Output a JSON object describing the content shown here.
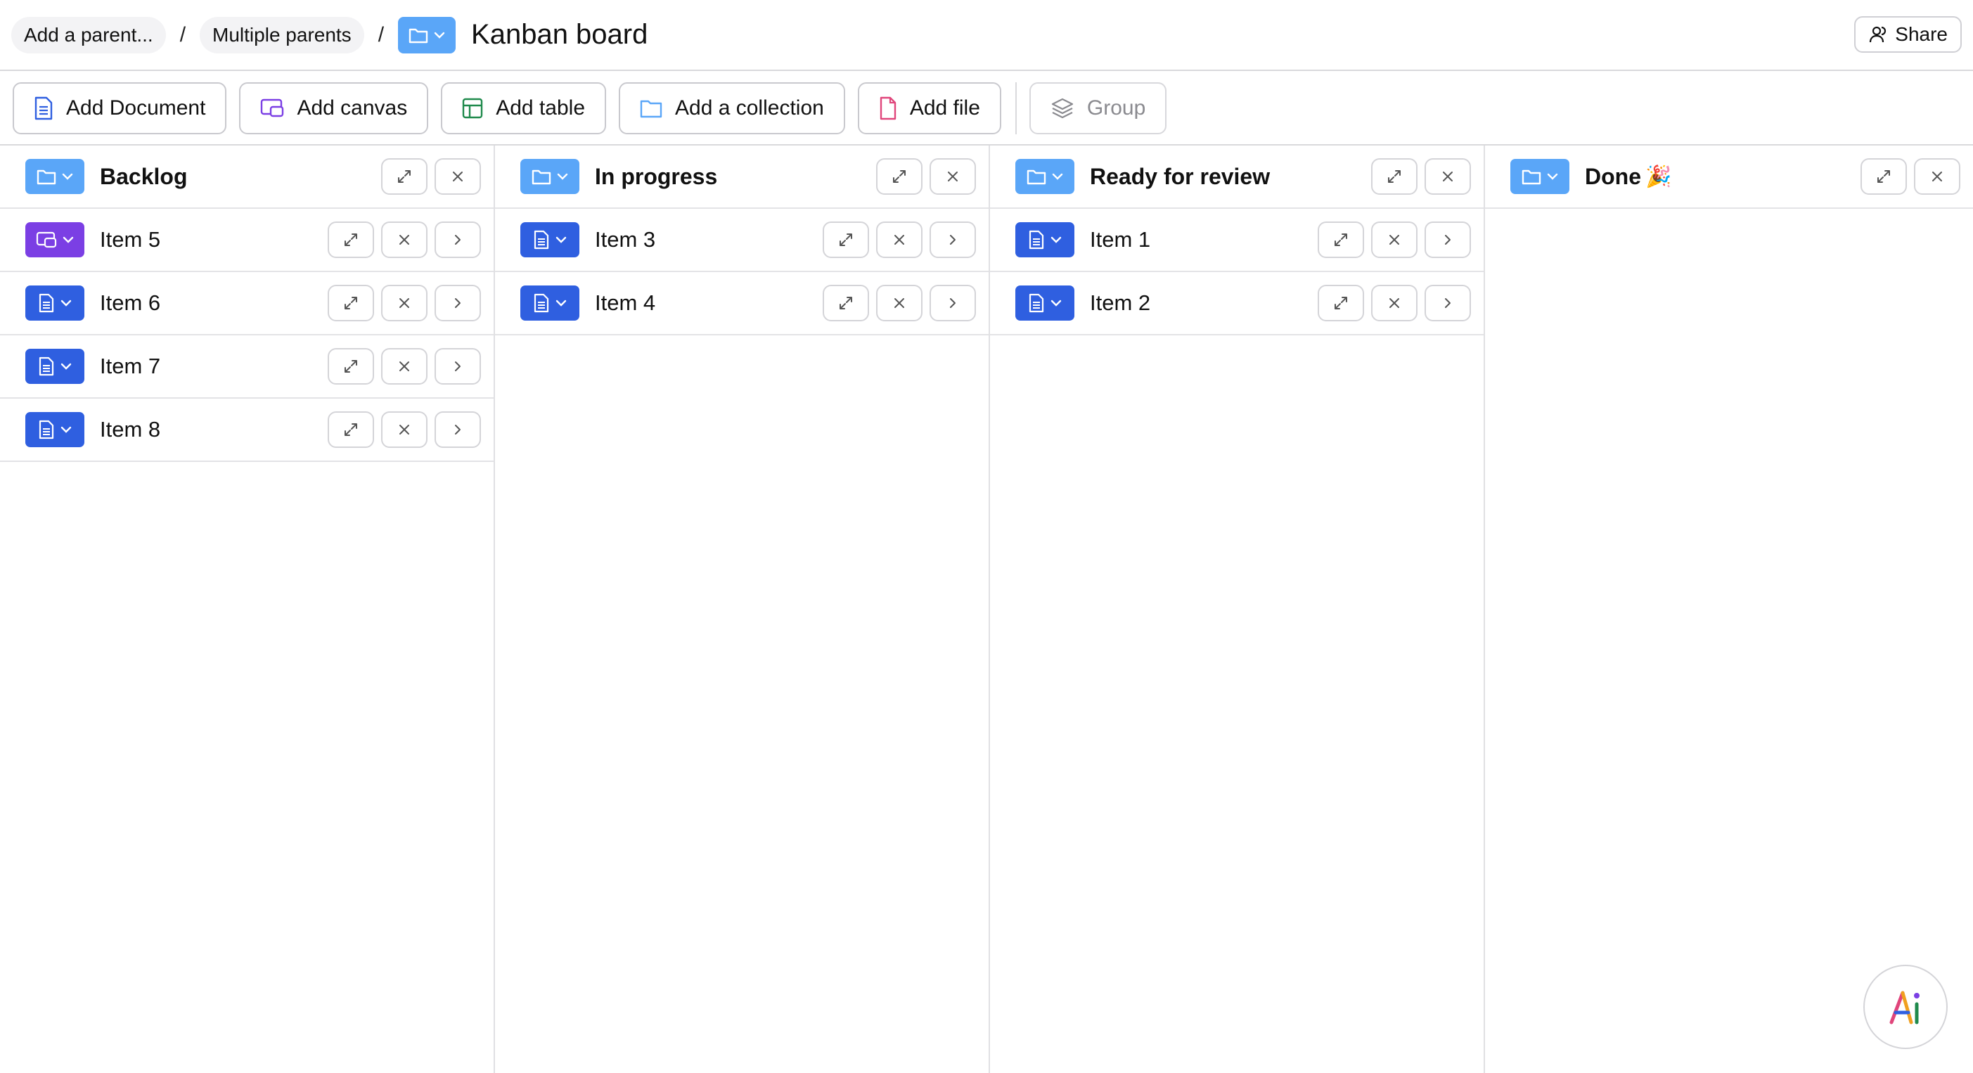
{
  "breadcrumb": {
    "items": [
      "Add a parent...",
      "Multiple parents"
    ],
    "separator": "/",
    "title": "Kanban board"
  },
  "share": {
    "label": "Share"
  },
  "toolbar": {
    "add_document": "Add Document",
    "add_canvas": "Add canvas",
    "add_table": "Add table",
    "add_collection": "Add a collection",
    "add_file": "Add file",
    "group": "Group"
  },
  "columns": [
    {
      "title": "Backlog",
      "emoji": "",
      "items": [
        {
          "title": "Item 5",
          "type": "canvas"
        },
        {
          "title": "Item 6",
          "type": "document"
        },
        {
          "title": "Item 7",
          "type": "document"
        },
        {
          "title": "Item 8",
          "type": "document"
        }
      ]
    },
    {
      "title": "In progress",
      "emoji": "",
      "items": [
        {
          "title": "Item 3",
          "type": "document"
        },
        {
          "title": "Item 4",
          "type": "document"
        }
      ]
    },
    {
      "title": "Ready for review",
      "emoji": "",
      "items": [
        {
          "title": "Item 1",
          "type": "document"
        },
        {
          "title": "Item 2",
          "type": "document"
        }
      ]
    },
    {
      "title": "Done",
      "emoji": "🎉",
      "items": []
    }
  ],
  "icons": {
    "folder": "folder-icon",
    "document": "document-icon",
    "canvas": "canvas-icon",
    "table": "table-icon",
    "file": "file-icon",
    "group": "layers-icon",
    "expand": "expand-icon",
    "close": "close-icon",
    "chevron": "chevron-right-icon",
    "ai": "ai-assistant-icon"
  },
  "colors": {
    "folder_accent": "#5aa6f8",
    "document_accent": "#2f5fe0",
    "canvas_accent": "#7b3fe4",
    "table_accent": "#1f8a4c",
    "file_accent": "#e0457b"
  }
}
